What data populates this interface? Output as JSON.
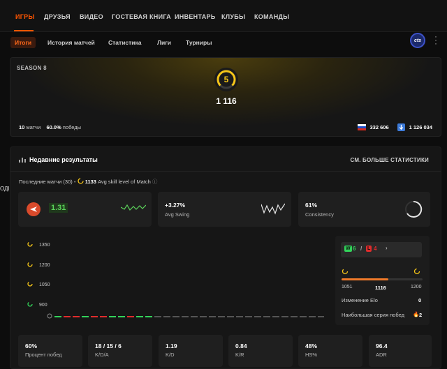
{
  "topnav": {
    "tabs": [
      "ИГРЫ",
      "ДРУЗЬЯ",
      "ВИДЕО",
      "ГОСТЕВАЯ КНИГА",
      "ИНВЕНТАРЬ",
      "КЛУБЫ",
      "КОМАНДЫ"
    ],
    "active": 0
  },
  "subnav": {
    "tabs": [
      "Итоги",
      "История матчей",
      "Статистика",
      "Лиги",
      "Турниры"
    ],
    "active": 0
  },
  "avatar": {
    "text": "cts"
  },
  "season": {
    "label": "SEASON 8",
    "level": "5",
    "elo": "1 116",
    "matches_value": "10",
    "matches_label": "матчи",
    "wins_value": "60.0%",
    "wins_label": "победы",
    "rank_country": "332 606",
    "rank_global": "1 126 034"
  },
  "recent": {
    "title": "Недавние результаты",
    "more": "СМ. БОЛЬШЕ СТАТИСТИКИ",
    "last_matches": "Последние матчи (30)",
    "avg_value": "1133",
    "avg_label": "Avg skill level of Match"
  },
  "cards": [
    {
      "value": "1.31",
      "label": ""
    },
    {
      "value": "+3.27%",
      "label": "Avg Swing"
    },
    {
      "value": "61%",
      "label": "Consistency"
    }
  ],
  "chart_data": {
    "type": "line",
    "y_ticks": [
      "1350",
      "1200",
      "1050",
      "900"
    ],
    "ylim": [
      900,
      1350
    ],
    "results": [
      "W",
      "L",
      "L",
      "W",
      "L",
      "L",
      "W",
      "W",
      "L",
      "W",
      "W",
      "N",
      "N",
      "N",
      "N",
      "N",
      "N",
      "N",
      "N",
      "N",
      "N",
      "N",
      "N",
      "N",
      "N",
      "N",
      "N",
      "N",
      "N",
      "N"
    ],
    "colors": {
      "W": "#32d35a",
      "L": "#e02c2c",
      "N": "#555555"
    }
  },
  "panel": {
    "wins": "6",
    "losses": "4",
    "w_letter": "W",
    "l_letter": "L",
    "elo_min": "1051",
    "elo_current": "1116",
    "elo_max": "1200",
    "progress": 0.58,
    "elo_change_label": "Изменение Elo",
    "elo_change_value": "0",
    "streak_label": "Наибольшая серия побед",
    "streak_value": "2"
  },
  "bottom": [
    {
      "value": "60%",
      "label": "Процент побед"
    },
    {
      "value": "18 / 15 / 6",
      "label": "K/D/A"
    },
    {
      "value": "1.19",
      "label": "K/D"
    },
    {
      "value": "0.84",
      "label": "K/R"
    },
    {
      "value": "48%",
      "label": "HS%"
    },
    {
      "value": "96.4",
      "label": "ADR"
    }
  ],
  "cutoff_text": "ОДI"
}
